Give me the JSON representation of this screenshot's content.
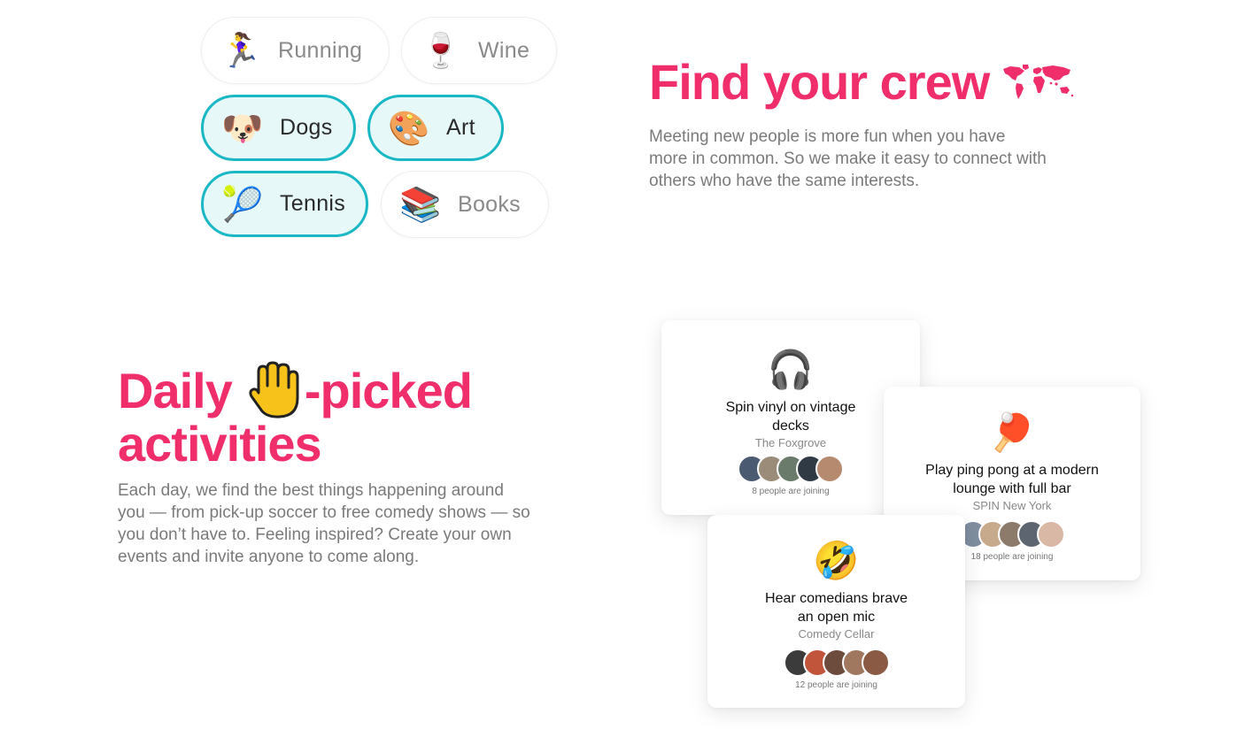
{
  "interests": [
    {
      "label": "Running",
      "emoji": "🏃‍♀️",
      "icon": "running-woman-icon",
      "selected": false
    },
    {
      "label": "Wine",
      "emoji": "🍷",
      "icon": "wine-glass-icon",
      "selected": false
    },
    {
      "label": "Dogs",
      "emoji": "🐶",
      "icon": "dog-face-icon",
      "selected": true
    },
    {
      "label": "Art",
      "emoji": "🎨",
      "icon": "artist-palette-icon",
      "selected": true
    },
    {
      "label": "Tennis",
      "emoji": "🎾",
      "icon": "tennis-ball-icon",
      "selected": true
    },
    {
      "label": "Books",
      "emoji": "📚",
      "icon": "books-icon",
      "selected": false
    }
  ],
  "crew": {
    "title": "Find your crew",
    "title_icon": "world-map-icon",
    "description": "Meeting new people is more fun when you have more in common. So we make it easy to connect with others who have the same interests."
  },
  "daily": {
    "title_part1": "Daily",
    "title_icon": "raised-hand-icon",
    "title_part2": "-picked",
    "title_line2": "activities",
    "description": "Each day, we find the best things happening around you — from pick-up soccer to free comedy shows — so you don’t have to. Feeling inspired? Create your own events and invite anyone to come along."
  },
  "activities": [
    {
      "emoji": "🎧",
      "icon": "headphones-icon",
      "title": "Spin vinyl on vintage decks",
      "venue": "The Foxgrove",
      "joining": "8 people are joining"
    },
    {
      "emoji": "🏓",
      "icon": "ping-pong-icon",
      "title": "Play ping pong at a modern lounge with full bar",
      "venue": "SPIN New York",
      "joining": "18 people are joining"
    },
    {
      "emoji": "🤣",
      "icon": "rolling-laughing-face-icon",
      "title": "Hear comedians brave an open mic",
      "venue": "Comedy Cellar",
      "joining": "12 people are joining"
    }
  ],
  "colors": {
    "accent": "#ef2e6b",
    "selected_border": "#19b8c4",
    "selected_fill": "#e6f8f8",
    "body_text": "#7a7a7a"
  }
}
